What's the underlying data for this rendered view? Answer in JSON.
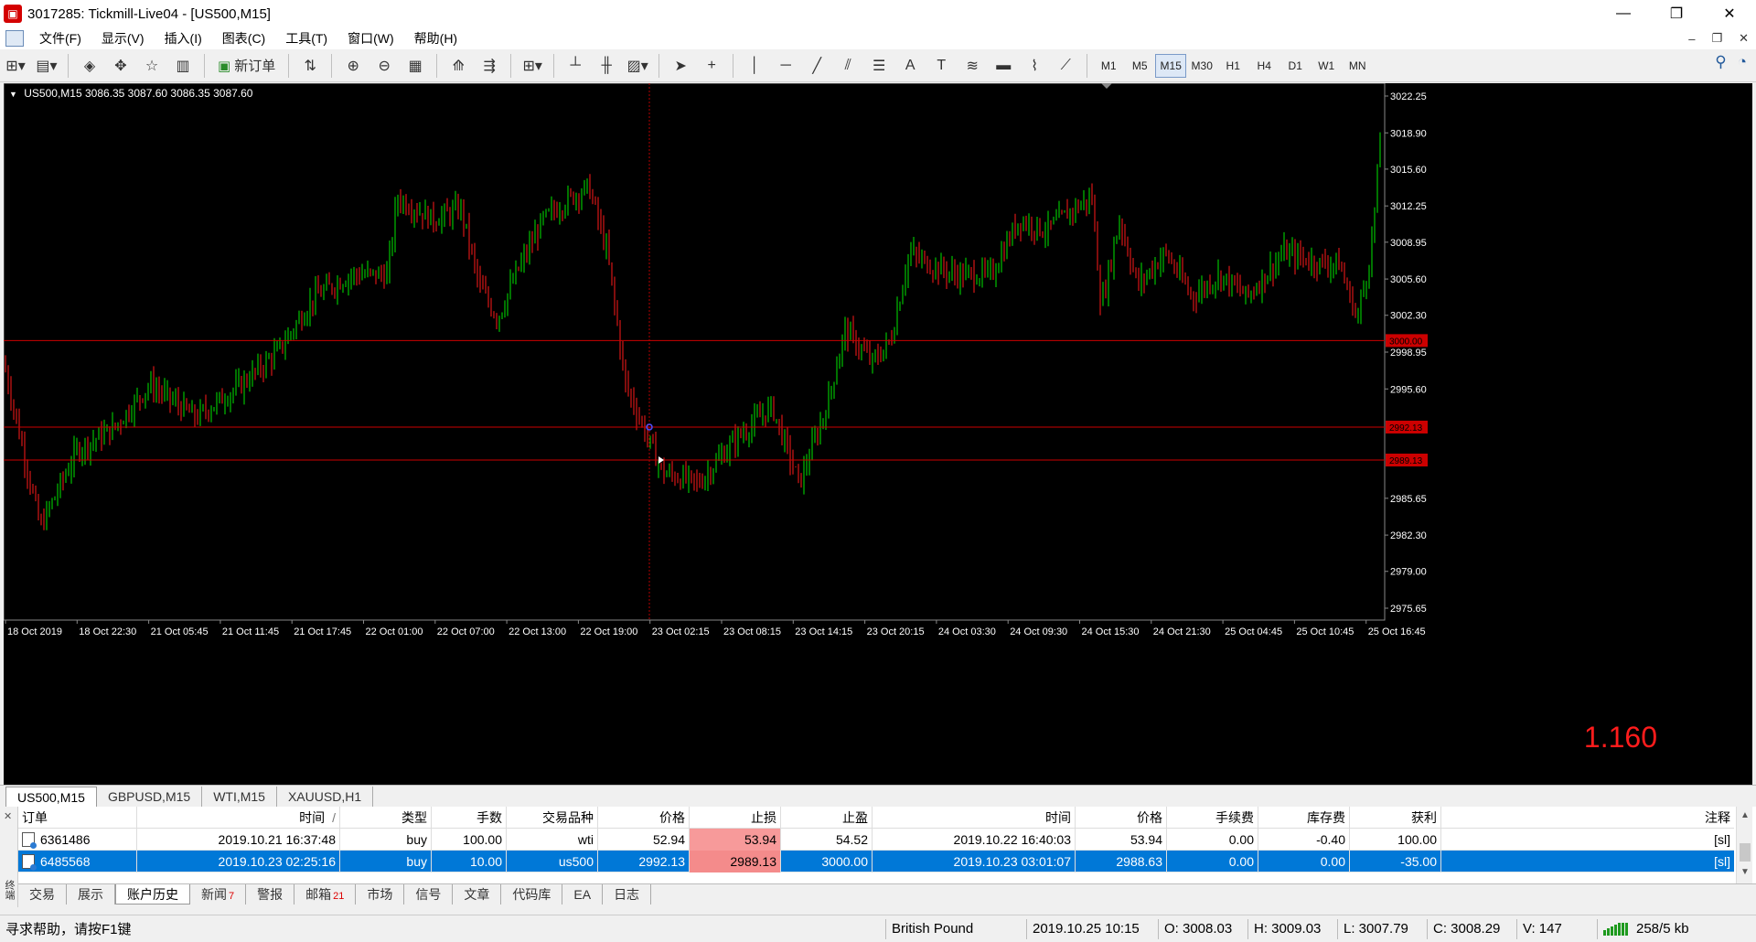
{
  "window": {
    "title": "3017285: Tickmill-Live04 - [US500,M15]",
    "icon": "mt4-app-icon",
    "controls": [
      "—",
      "❐",
      "✕"
    ]
  },
  "menu": {
    "items": [
      "文件(F)",
      "显示(V)",
      "插入(I)",
      "图表(C)",
      "工具(T)",
      "窗口(W)",
      "帮助(H)"
    ],
    "mdi_controls": [
      "–",
      "❐",
      "✕"
    ]
  },
  "toolbar": {
    "new_order_label": "新订单",
    "timeframes": [
      "M1",
      "M5",
      "M15",
      "M30",
      "H1",
      "H4",
      "D1",
      "W1",
      "MN"
    ],
    "active_timeframe": "M15"
  },
  "chart": {
    "header": "US500,M15  3086.35 3087.60 3086.35 3087.60",
    "spread": "1.160",
    "price_ticks": [
      "3022.25",
      "3018.90",
      "3015.60",
      "3012.25",
      "3008.95",
      "3005.60",
      "3002.30",
      "2998.95",
      "2995.60",
      "2985.65",
      "2982.30",
      "2979.00",
      "2975.65"
    ],
    "level_labels": [
      "3000.00",
      "2992.13",
      "2989.13"
    ],
    "time_ticks": [
      "18 Oct 2019",
      "18 Oct 22:30",
      "21 Oct 05:45",
      "21 Oct 11:45",
      "21 Oct 17:45",
      "22 Oct 01:00",
      "22 Oct 07:00",
      "22 Oct 13:00",
      "22 Oct 19:00",
      "23 Oct 02:15",
      "23 Oct 08:15",
      "23 Oct 14:15",
      "23 Oct 20:15",
      "24 Oct 03:30",
      "24 Oct 09:30",
      "24 Oct 15:30",
      "24 Oct 21:30",
      "25 Oct 04:45",
      "25 Oct 10:45",
      "25 Oct 16:45"
    ],
    "colors": {
      "background": "#000000",
      "bull": "#00e600",
      "bear": "#ff1a1a",
      "level_line": "#cc0000",
      "axis_text": "#ffffff"
    }
  },
  "chart_tabs": [
    "US500,M15",
    "GBPUSD,M15",
    "WTI,M15",
    "XAUUSD,H1"
  ],
  "history": {
    "columns": [
      "订单",
      "时间",
      "类型",
      "手数",
      "交易品种",
      "价格",
      "止损",
      "止盈",
      "时间",
      "价格",
      "手续费",
      "库存费",
      "获利",
      "注释"
    ],
    "sort_indicator": "/",
    "rows": [
      {
        "order": "6361486",
        "open_time": "2019.10.21 16:37:48",
        "type": "buy",
        "lots": "100.00",
        "symbol": "wti",
        "open_price": "52.94",
        "sl": "53.94",
        "tp": "54.52",
        "close_time": "2019.10.22 16:40:03",
        "close_price": "53.94",
        "commission": "0.00",
        "swap": "-0.40",
        "profit": "100.00",
        "comment": "[sl]"
      },
      {
        "order": "6485568",
        "open_time": "2019.10.23 02:25:16",
        "type": "buy",
        "lots": "10.00",
        "symbol": "us500",
        "open_price": "2992.13",
        "sl": "2989.13",
        "tp": "3000.00",
        "close_time": "2019.10.23 03:01:07",
        "close_price": "2988.63",
        "commission": "0.00",
        "swap": "0.00",
        "profit": "-35.00",
        "comment": "[sl]"
      }
    ]
  },
  "terminal": {
    "side_label": "终端",
    "tabs": [
      {
        "label": "交易",
        "badge": ""
      },
      {
        "label": "展示",
        "badge": ""
      },
      {
        "label": "账户历史",
        "badge": ""
      },
      {
        "label": "新闻",
        "badge": "7"
      },
      {
        "label": "警报",
        "badge": ""
      },
      {
        "label": "邮箱",
        "badge": "21"
      },
      {
        "label": "市场",
        "badge": ""
      },
      {
        "label": "信号",
        "badge": ""
      },
      {
        "label": "文章",
        "badge": ""
      },
      {
        "label": "代码库",
        "badge": ""
      },
      {
        "label": "EA",
        "badge": ""
      },
      {
        "label": "日志",
        "badge": ""
      }
    ],
    "active_tab": "账户历史"
  },
  "status": {
    "help": "寻求帮助，请按F1键",
    "profile": "British Pound",
    "datetime": "2019.10.25 10:15",
    "open": "O: 3008.03",
    "high": "H: 3009.03",
    "low": "L: 3007.79",
    "close": "C: 3008.29",
    "volume": "V: 147",
    "connection": "258/5 kb"
  }
}
